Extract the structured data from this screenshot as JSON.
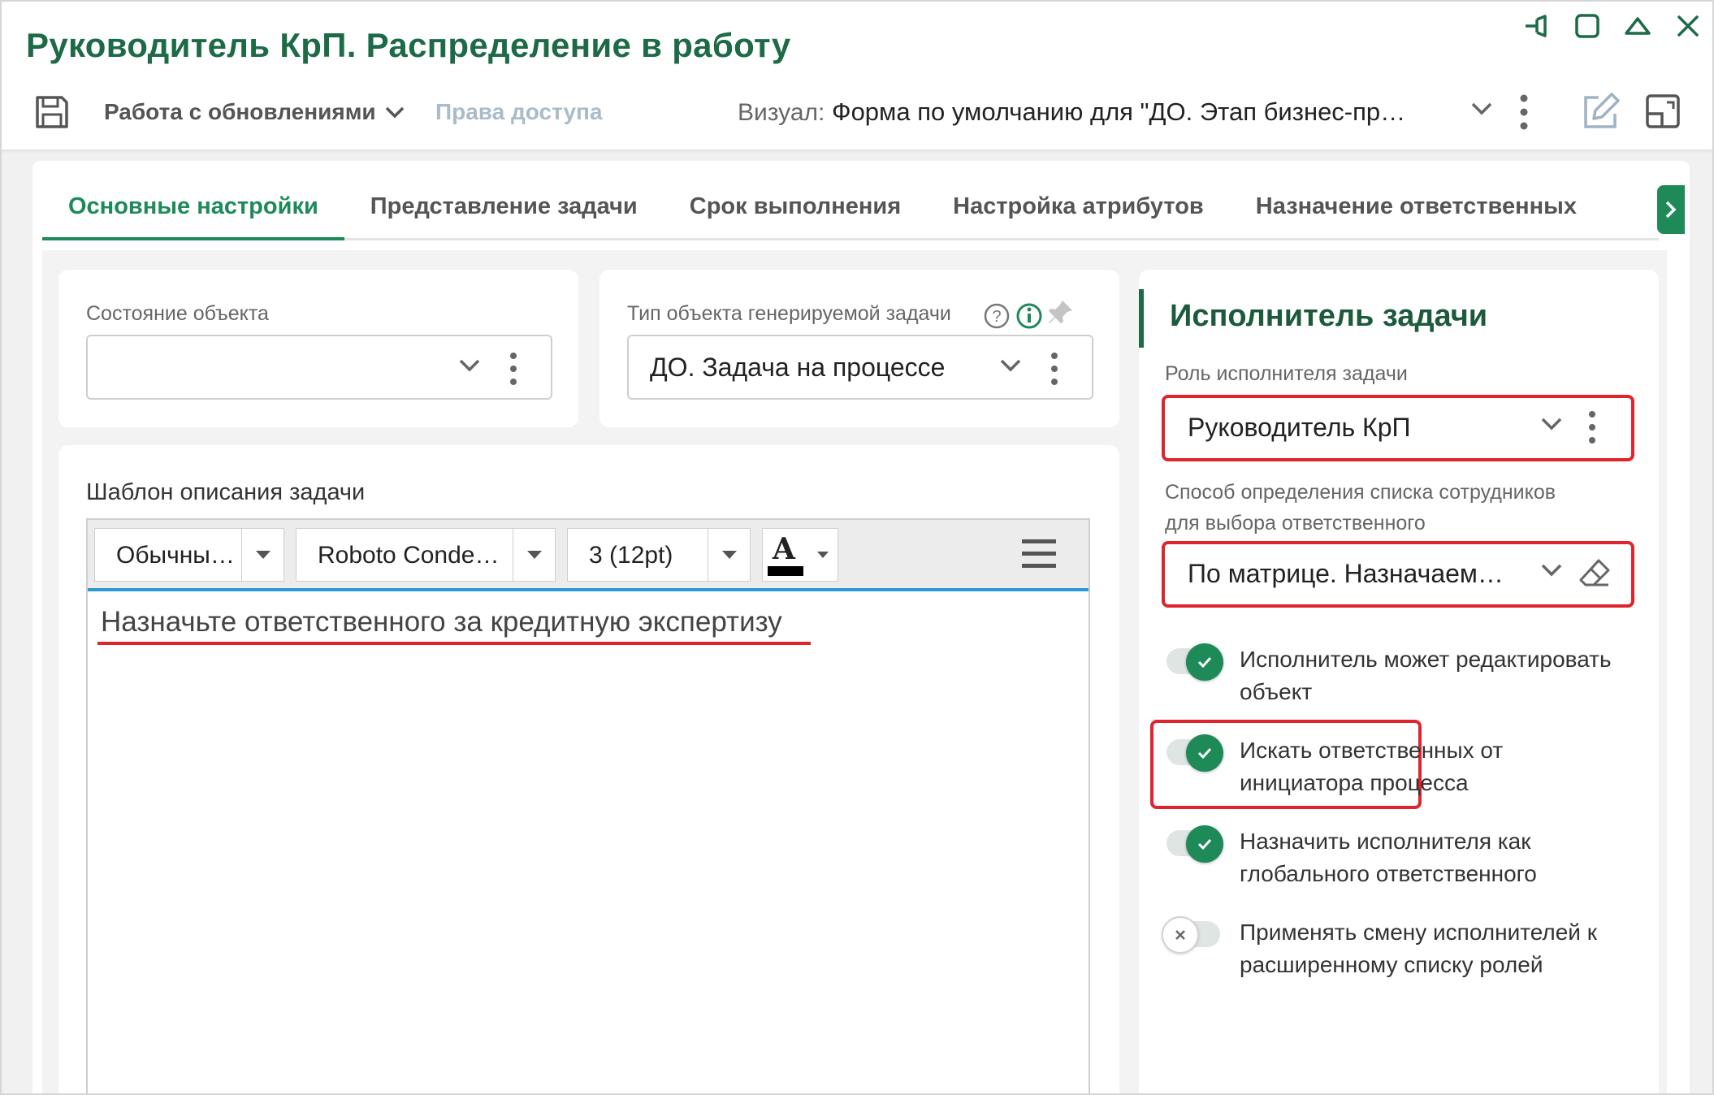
{
  "window": {
    "title": "Руководитель КрП. Распределение в работу"
  },
  "toolbar": {
    "menu_label": "Работа с обновлениями",
    "rights_label": "Права доступа",
    "visual_label": "Визуал:",
    "visual_value": "Форма по умолчанию для \"ДО. Этап бизнес-пр…"
  },
  "tabs": [
    {
      "label": "Основные настройки",
      "active": true
    },
    {
      "label": "Представление задачи",
      "active": false
    },
    {
      "label": "Срок выполнения",
      "active": false
    },
    {
      "label": "Настройка атрибутов",
      "active": false
    },
    {
      "label": "Назначение ответственных",
      "active": false
    }
  ],
  "object_state": {
    "label": "Состояние объекта",
    "value": ""
  },
  "task_object_type": {
    "label": "Тип объекта генерируемой задачи",
    "value": "ДО. Задача на процессе"
  },
  "editor": {
    "label": "Шаблон описания задачи",
    "style_value": "Обычны…",
    "font_value": "Roboto Conde…",
    "size_value": "3 (12pt)",
    "font_color_glyph": "A",
    "content": "Назначьте ответственного за кредитную экспертизу"
  },
  "executor": {
    "title": "Исполнитель задачи",
    "role_label": "Роль исполнителя задачи",
    "role_value": "Руководитель КрП",
    "method_label_line1": "Способ определения списка сотрудников",
    "method_label_line2": "для выбора ответственного",
    "method_value": "По матрице. Назначаем…",
    "toggles": [
      {
        "line1": "Исполнитель может редактировать",
        "line2": "объект",
        "on": true
      },
      {
        "line1": "Искать ответственных от",
        "line2": "инициатора процесса",
        "on": true
      },
      {
        "line1": "Назначить исполнителя как",
        "line2": "глобального ответственного",
        "on": true
      },
      {
        "line1": "Применять смену исполнителей к",
        "line2": "расширенному списку ролей",
        "on": false
      }
    ]
  },
  "colors": {
    "brand_green": "#1d6b46",
    "accent_green": "#1d8a58",
    "highlight_red": "#e0232d",
    "editor_blue": "#2a9ad8"
  }
}
